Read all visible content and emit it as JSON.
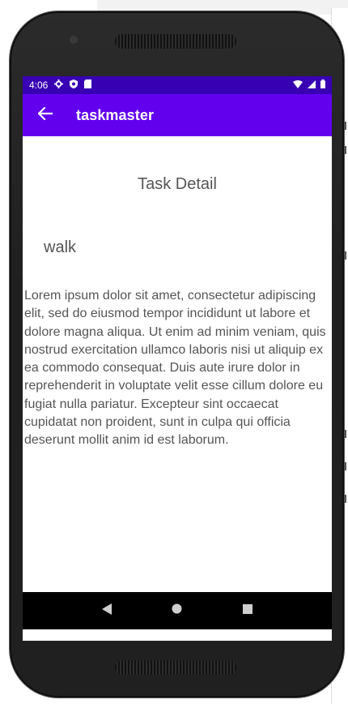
{
  "status_bar": {
    "time": "4:06",
    "icons_left": [
      "gear-icon",
      "shield-icon",
      "sd-card-icon"
    ],
    "icons_right": [
      "wifi-icon",
      "signal-icon",
      "battery-icon"
    ]
  },
  "app_bar": {
    "title": "taskmaster",
    "back_icon": "arrow-left-icon"
  },
  "content": {
    "heading": "Task Detail",
    "task_title": "walk",
    "task_body": "Lorem ipsum dolor sit amet, consectetur adipiscing elit, sed do eiusmod tempor incididunt ut labore et dolore magna aliqua. Ut enim ad minim veniam, quis nostrud exercitation ullamco laboris nisi ut aliquip ex ea commodo consequat. Duis aute irure dolor in reprehenderit in voluptate velit esse cillum dolore eu fugiat nulla pariatur. Excepteur sint occaecat cupidatat non proident, sunt in culpa qui officia deserunt mollit anim id est laborum."
  },
  "nav_bar": {
    "icons": [
      "back-triangle-icon",
      "home-circle-icon",
      "recents-square-icon"
    ]
  },
  "colors": {
    "status_bar": "#3700b3",
    "app_bar": "#6200ee",
    "text": "#555555"
  }
}
